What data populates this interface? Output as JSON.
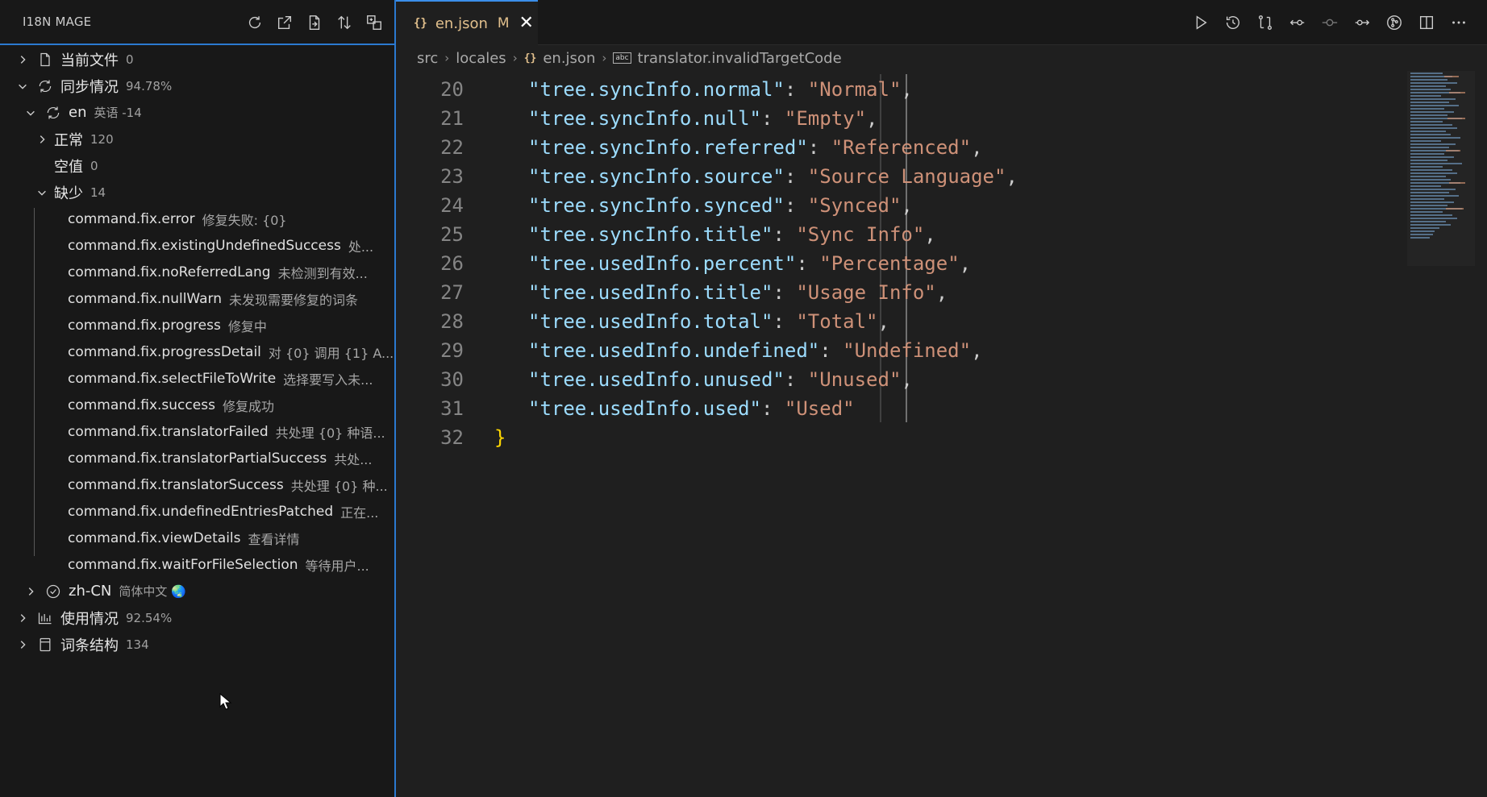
{
  "sidebar": {
    "title": "I18N MAGE",
    "actions": [
      "refresh-icon",
      "open-external-icon",
      "export-icon",
      "sort-icon",
      "translate-icon"
    ],
    "tree": [
      {
        "label": "当前文件",
        "desc": "0",
        "icon": "file-icon",
        "expanded": false
      },
      {
        "label": "同步情况",
        "desc": "94.78%",
        "icon": "sync-icon",
        "expanded": true
      },
      {
        "label": "en",
        "desc": "英语 -14",
        "icon": "sync-icon",
        "expanded": true
      },
      {
        "label": "正常",
        "desc": "120",
        "expanded": false
      },
      {
        "label": "空值",
        "desc": "0"
      },
      {
        "label": "缺少",
        "desc": "14",
        "expanded": true
      },
      {
        "label": "zh-CN",
        "desc": "简体中文 🌏",
        "icon": "check-circle-icon",
        "expanded": false
      },
      {
        "label": "使用情况",
        "desc": "92.54%",
        "icon": "chart-icon",
        "expanded": false
      },
      {
        "label": "词条结构",
        "desc": "134",
        "icon": "structure-icon",
        "expanded": false
      }
    ],
    "missing_items": [
      {
        "key": "command.fix.error",
        "value": "修复失败: {0}"
      },
      {
        "key": "command.fix.existingUndefinedSuccess",
        "value": "处..."
      },
      {
        "key": "command.fix.noReferredLang",
        "value": "未检测到有效..."
      },
      {
        "key": "command.fix.nullWarn",
        "value": "未发现需要修复的词条"
      },
      {
        "key": "command.fix.progress",
        "value": "修复中"
      },
      {
        "key": "command.fix.progressDetail",
        "value": "对 {0} 调用 {1} A..."
      },
      {
        "key": "command.fix.selectFileToWrite",
        "value": "选择要写入未..."
      },
      {
        "key": "command.fix.success",
        "value": "修复成功"
      },
      {
        "key": "command.fix.translatorFailed",
        "value": "共处理 {0} 种语..."
      },
      {
        "key": "command.fix.translatorPartialSuccess",
        "value": "共处..."
      },
      {
        "key": "command.fix.translatorSuccess",
        "value": "共处理 {0} 种..."
      },
      {
        "key": "command.fix.undefinedEntriesPatched",
        "value": "正在..."
      },
      {
        "key": "command.fix.viewDetails",
        "value": "查看详情"
      },
      {
        "key": "command.fix.waitForFileSelection",
        "value": "等待用户..."
      }
    ]
  },
  "editor": {
    "tab": {
      "icon": "{}",
      "label": "en.json",
      "badge": "M"
    },
    "actions": [
      "run-icon",
      "history-icon",
      "compare-icon",
      "revert-icon",
      "commit-icon",
      "forward-icon",
      "git-graph-icon",
      "split-editor-icon",
      "more-icon"
    ],
    "breadcrumb": {
      "parts": [
        "src",
        "locales",
        "en.json",
        "translator.invalidTargetCode"
      ],
      "json_icon": "{}",
      "key_icon": "abc"
    },
    "code_lines": [
      {
        "n": "20",
        "key": "\"tree.syncInfo.normal\"",
        "value": "\"Normal\"",
        "comma": ","
      },
      {
        "n": "21",
        "key": "\"tree.syncInfo.null\"",
        "value": "\"Empty\"",
        "comma": ","
      },
      {
        "n": "22",
        "key": "\"tree.syncInfo.referred\"",
        "value": "\"Referenced\"",
        "comma": ","
      },
      {
        "n": "23",
        "key": "\"tree.syncInfo.source\"",
        "value": "\"Source Language\"",
        "comma": ","
      },
      {
        "n": "24",
        "key": "\"tree.syncInfo.synced\"",
        "value": "\"Synced\"",
        "comma": ","
      },
      {
        "n": "25",
        "key": "\"tree.syncInfo.title\"",
        "value": "\"Sync Info\"",
        "comma": ","
      },
      {
        "n": "26",
        "key": "\"tree.usedInfo.percent\"",
        "value": "\"Percentage\"",
        "comma": ","
      },
      {
        "n": "27",
        "key": "\"tree.usedInfo.title\"",
        "value": "\"Usage Info\"",
        "comma": ","
      },
      {
        "n": "28",
        "key": "\"tree.usedInfo.total\"",
        "value": "\"Total\"",
        "comma": ","
      },
      {
        "n": "29",
        "key": "\"tree.usedInfo.undefined\"",
        "value": "\"Undefined\"",
        "comma": ","
      },
      {
        "n": "30",
        "key": "\"tree.usedInfo.unused\"",
        "value": "\"Unused\"",
        "comma": ","
      },
      {
        "n": "31",
        "key": "\"tree.usedInfo.used\"",
        "value": "\"Used\"",
        "comma": ""
      }
    ],
    "closing_line": {
      "n": "32",
      "text": "}"
    },
    "colors": {
      "key": "#9cdcfe",
      "string": "#ce9178",
      "bracket": "#ffd700",
      "tab_modified": "#e2c08d",
      "focus": "#2b79d0"
    }
  }
}
